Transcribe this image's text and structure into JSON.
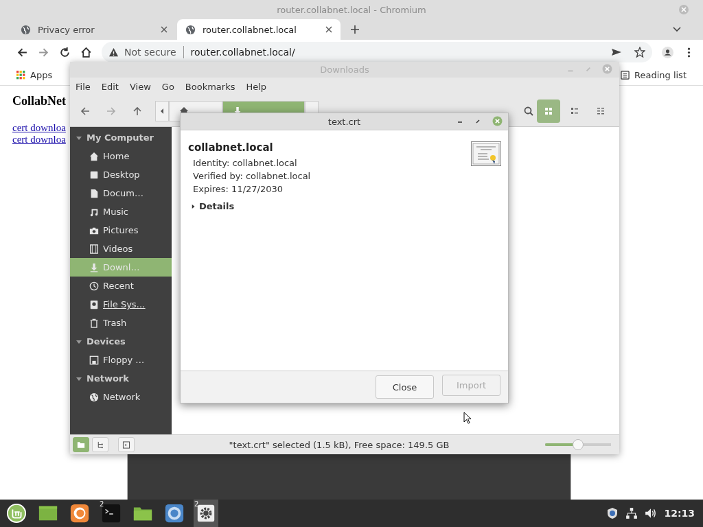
{
  "browser": {
    "title": "router.collabnet.local - Chromium",
    "tabs": [
      {
        "label": "Privacy error",
        "selected": false
      },
      {
        "label": "router.collabnet.local",
        "selected": true
      }
    ],
    "security": "Not secure",
    "url": "router.collabnet.local/",
    "bookmarks": [
      "Apps"
    ],
    "reading_list": "Reading list",
    "page": {
      "heading": "CollabNet",
      "links": [
        "cert downloa",
        "cert downloa"
      ]
    }
  },
  "file_manager": {
    "title": "Downloads",
    "menu": [
      "File",
      "Edit",
      "View",
      "Go",
      "Bookmarks",
      "Help"
    ],
    "breadcrumb": [
      {
        "kind": "home",
        "selected": false
      },
      {
        "kind": "download",
        "selected": true
      }
    ],
    "views": [
      {
        "kind": "icons",
        "selected": true
      },
      {
        "kind": "list",
        "selected": false
      },
      {
        "kind": "compact",
        "selected": false
      }
    ],
    "sidebar": [
      {
        "heading": "My Computer",
        "expanded": true,
        "items": [
          {
            "label": "Home",
            "kind": "home",
            "selected": false,
            "hovered": false
          },
          {
            "label": "Desktop",
            "kind": "desktop",
            "selected": false,
            "hovered": false
          },
          {
            "label": "Docum…",
            "kind": "document",
            "selected": false,
            "hovered": false
          },
          {
            "label": "Music",
            "kind": "music",
            "selected": false,
            "hovered": false
          },
          {
            "label": "Pictures",
            "kind": "camera",
            "selected": false,
            "hovered": false
          },
          {
            "label": "Videos",
            "kind": "film",
            "selected": false,
            "hovered": false
          },
          {
            "label": "Downl…",
            "kind": "download",
            "selected": true,
            "hovered": false
          },
          {
            "label": "Recent",
            "kind": "clock",
            "selected": false,
            "hovered": false
          },
          {
            "label": "File Sys…",
            "kind": "disk",
            "selected": false,
            "hovered": true
          },
          {
            "label": "Trash",
            "kind": "trash",
            "selected": false,
            "hovered": false
          }
        ]
      },
      {
        "heading": "Devices",
        "expanded": true,
        "items": [
          {
            "label": "Floppy …",
            "kind": "floppy",
            "selected": false,
            "hovered": false
          }
        ]
      },
      {
        "heading": "Network",
        "expanded": true,
        "items": [
          {
            "label": "Network",
            "kind": "globe",
            "selected": false,
            "hovered": false
          }
        ]
      }
    ],
    "status": "\"text.crt\" selected (1.5 kB), Free space: 149.5 GB",
    "zoom": {
      "level": 0.5
    }
  },
  "dialog": {
    "title": "text.crt",
    "subject": "collabnet.local",
    "fields": [
      "Identity: collabnet.local",
      "Verified by: collabnet.local",
      "Expires: 11/27/2030"
    ],
    "details": {
      "label": "Details",
      "expanded": false
    },
    "buttons": [
      {
        "label": "Close",
        "disabled": false
      },
      {
        "label": "Import",
        "disabled": true
      }
    ]
  },
  "taskbar": {
    "apps": [
      {
        "kind": "mint",
        "active": false
      },
      {
        "kind": "desktop",
        "active": false
      },
      {
        "kind": "firefox",
        "active": false
      },
      {
        "kind": "terminal",
        "badge": "2",
        "active": false
      },
      {
        "kind": "folder",
        "active": false
      },
      {
        "kind": "chromium",
        "active": false
      },
      {
        "kind": "settings",
        "badge": "2",
        "active": true
      }
    ],
    "clock": "12:13"
  }
}
